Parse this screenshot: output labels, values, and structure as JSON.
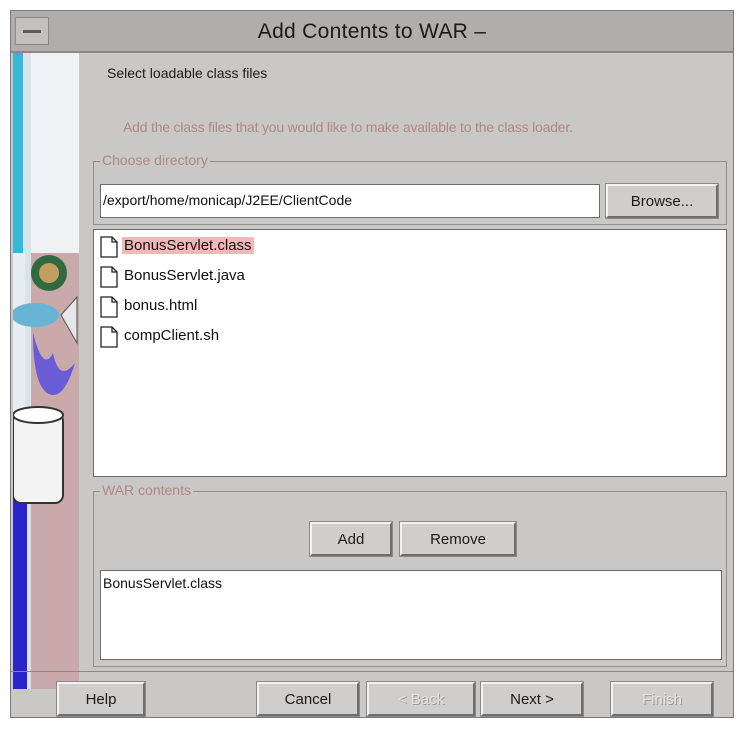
{
  "window": {
    "title": "Add Contents to WAR –"
  },
  "page": {
    "heading": "Select loadable class files",
    "instruction": "Add the class files that you would like to make available to the class loader."
  },
  "directory": {
    "group_label": "Choose directory",
    "path": "/export/home/monicap/J2EE/ClientCode",
    "browse_label": "Browse..."
  },
  "files": [
    {
      "name": "BonusServlet.class",
      "selected": true
    },
    {
      "name": "BonusServlet.java",
      "selected": false
    },
    {
      "name": "bonus.html",
      "selected": false
    },
    {
      "name": "compClient.sh",
      "selected": false
    }
  ],
  "war": {
    "group_label": "WAR contents",
    "add_label": "Add",
    "remove_label": "Remove",
    "contents": [
      "BonusServlet.class"
    ]
  },
  "footer": {
    "help": "Help",
    "cancel": "Cancel",
    "back": "< Back",
    "next": "Next >",
    "finish": "Finish"
  },
  "icons": {
    "sysmenu": "window-menu-icon",
    "file": "document-icon"
  }
}
